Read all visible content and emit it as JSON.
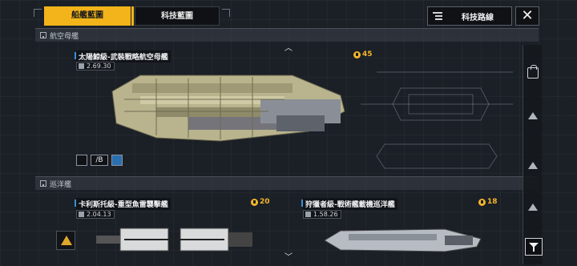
{
  "header": {
    "tabs": [
      {
        "label": "船艦藍圖",
        "active": true
      },
      {
        "label": "科技藍圖",
        "active": false
      }
    ],
    "tech_route_label": "科技路線",
    "close_symbol": "✕"
  },
  "sections": {
    "carrier": {
      "label": "航空母艦"
    },
    "cruiser": {
      "label": "巡洋艦"
    }
  },
  "ships": [
    {
      "name": "太陽鯨級-武裝戰略航空母艦",
      "stat": "2.69.30",
      "cost": "45",
      "tier": "/B"
    },
    {
      "name": "卡利斯托級-重型魚雷襲擊艦",
      "stat": "2.04.13",
      "cost": "20"
    },
    {
      "name": "狩獵者級-戰術艦載機巡洋艦",
      "stat": "1.58.26",
      "cost": "18"
    }
  ],
  "colors": {
    "accent": "#f3b41b",
    "cost": "#f4b52a",
    "name_marker": "#3a8fd6"
  },
  "icons": [
    "menu-lines-icon",
    "close-icon",
    "home-icon",
    "chevron-up-icon",
    "chevron-down-icon",
    "lock-icon",
    "triangle-icon",
    "filter-icon",
    "emblem-icon",
    "coin-icon"
  ]
}
